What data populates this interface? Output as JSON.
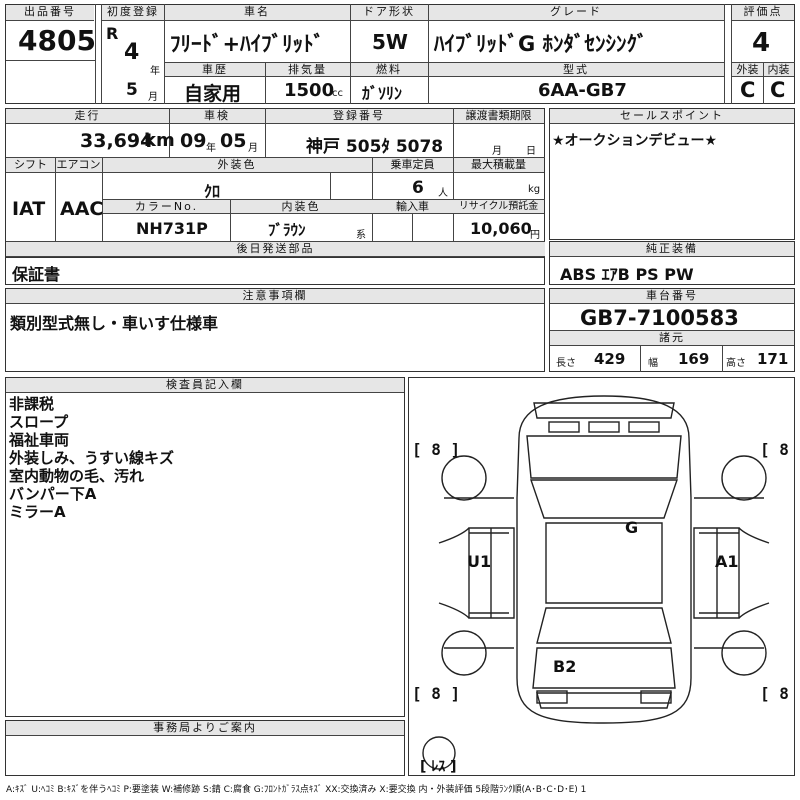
{
  "header": {
    "lot_label": "出品番号",
    "lot": "4805",
    "first_reg_label": "初度登録",
    "era": "R",
    "reg_year": "4",
    "year_unit": "年",
    "reg_month": "5",
    "month_unit": "月",
    "car_name_label": "車名",
    "car_name": "ﾌﾘｰﾄﾞ+ﾊｲﾌﾞﾘｯﾄﾞ",
    "door_label": "ドア形状",
    "door": "5W",
    "grade_label": "グレード",
    "grade": "ﾊｲﾌﾞﾘｯﾄﾞG ﾎﾝﾀﾞｾﾝｼﾝｸﾞ",
    "score_label": "評価点",
    "score": "4",
    "history_label": "車歴",
    "history": "自家用",
    "displacement_label": "排気量",
    "displacement": "1500",
    "cc": "cc",
    "fuel_label": "燃料",
    "fuel": "ｶﾞｿﾘﾝ",
    "model_label": "型式",
    "model": "6AA-GB7",
    "ext_label": "外装",
    "ext_score": "C",
    "int_label": "内装",
    "int_score": "C"
  },
  "row2": {
    "mileage_label": "走行",
    "mileage": "33,694",
    "km": "km",
    "inspection_label": "車検",
    "insp_year": "09",
    "insp_year_unit": "年",
    "insp_month": "05",
    "insp_month_unit": "月",
    "plate_label": "登録番号",
    "plate": "神戸 505ﾀ 5078",
    "transfer_label": "譲渡書類期限",
    "transfer_month_unit": "月",
    "transfer_day_unit": "日",
    "shift_label": "シフト",
    "shift": "IAT",
    "ac_label": "エアコン",
    "ac": "AAC",
    "ext_color_label": "外装色",
    "ext_color": "ｸﾛ",
    "capacity_label": "乗車定員",
    "capacity": "6",
    "person_unit": "人",
    "max_load_label": "最大積載量",
    "kg": "kg",
    "color_no_label": "カラーNo.",
    "color_no": "NH731P",
    "int_color_label": "内装色",
    "int_color": "ﾌﾞﾗｳﾝ",
    "int_color_suffix": "系",
    "import_label": "輸入車",
    "recycle_label": "リサイクル預託金",
    "recycle": "10,060",
    "yen": "円"
  },
  "sales_point": {
    "label": "セールスポイント",
    "text": "★オークションデビュー★"
  },
  "later_parts": {
    "label": "後日発送部品",
    "text": "保証書"
  },
  "genuine_equipment": {
    "label": "純正装備",
    "text": "ABS ｴｱB PS PW"
  },
  "notes": {
    "label": "注意事項欄",
    "text": "類別型式無し・車いす仕様車"
  },
  "chassis": {
    "label": "車台番号",
    "value": "GB7-7100583"
  },
  "dims": {
    "label": "諸元",
    "length_label": "長さ",
    "length": "429",
    "width_label": "幅",
    "width": "169",
    "height_label": "高さ",
    "height": "171"
  },
  "inspector": {
    "label": "検査員記入欄",
    "lines": [
      "非課税",
      "スロープ",
      "福祉車両",
      "外装しみ、うすい線キズ",
      "室内動物の毛、汚れ",
      "バンパー下A",
      "ミラーA"
    ]
  },
  "diagram": {
    "tire_fl": "8",
    "tire_fr": "8",
    "tire_rl": "8",
    "tire_rr": "8",
    "mark_roof": "G",
    "mark_left": "U1",
    "mark_right": "A1",
    "mark_rear": "B2",
    "spare": "ﾚｽ"
  },
  "office": {
    "label": "事務局よりご案内"
  },
  "legend": "A:ｷｽﾞ U:ﾍｺﾐ B:ｷｽﾞを伴うﾍｺﾐ P:要塗装 W:補修跡 S:錆 C:腐食 G:ﾌﾛﾝﾄｶﾞﾗｽ点ｷｽﾞ XX:交換済み X:要交換  内・外装評価 5段階ﾗﾝｸ順(A･B･C･D･E) 1"
}
